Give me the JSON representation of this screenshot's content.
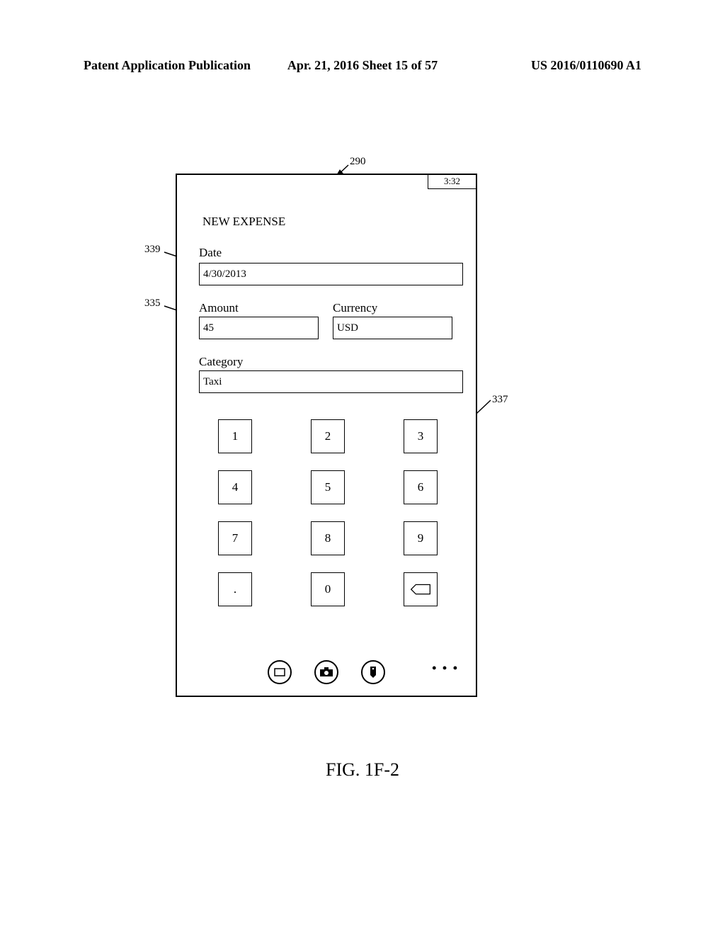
{
  "header": {
    "left": "Patent Application Publication",
    "center": "Apr. 21, 2016  Sheet 15 of 57",
    "right": "US 2016/0110690 A1"
  },
  "callouts": {
    "c290": "290",
    "c339": "339",
    "c335": "335",
    "c337": "337"
  },
  "device": {
    "status_time": "3:32",
    "title": "NEW EXPENSE",
    "date_label": "Date",
    "date_value": "4/30/2013",
    "amount_label": "Amount",
    "amount_value": "45",
    "currency_label": "Currency",
    "currency_value": "USD",
    "category_label": "Category",
    "category_value": "Taxi",
    "keypad": {
      "k1": "1",
      "k2": "2",
      "k3": "3",
      "k4": "4",
      "k5": "5",
      "k6": "6",
      "k7": "7",
      "k8": "8",
      "k9": "9",
      "kdot": ".",
      "k0": "0"
    }
  },
  "figure_label": "FIG. 1F-2"
}
